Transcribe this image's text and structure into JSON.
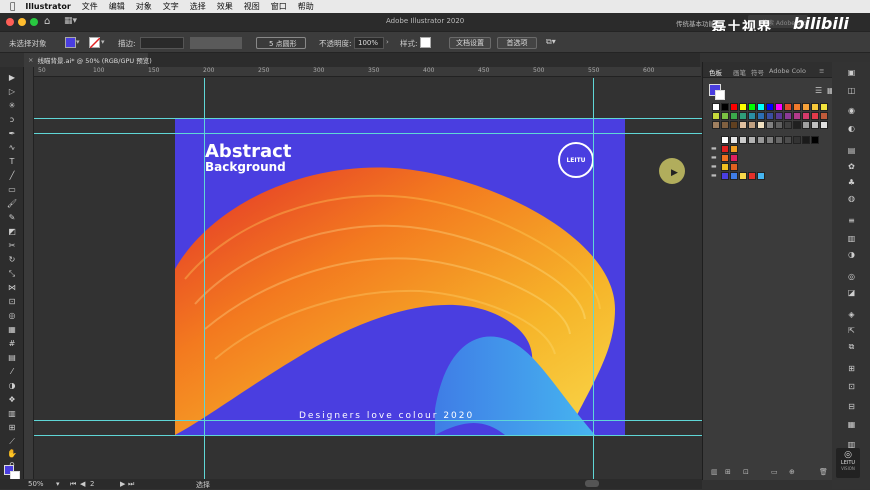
{
  "menubar": {
    "apple": "",
    "app_name": "Illustrator",
    "items": [
      "文件",
      "编辑",
      "对象",
      "文字",
      "选择",
      "效果",
      "视图",
      "窗口",
      "帮助"
    ]
  },
  "appbar": {
    "window_title": "Adobe Illustrator 2020",
    "workspace": "传统基本功能",
    "search_placeholder": "搜索 Adobe Stock",
    "watermark_text": "磊土视界",
    "watermark_logo": "bilibili"
  },
  "control": {
    "selection_label": "未选择对象",
    "stroke_label": "描边:",
    "brush_label": "5 点圆形",
    "opacity_label": "不透明度:",
    "opacity_value": "100%",
    "style_label": "样式:",
    "doc_setup_button": "文档设置",
    "prefs_button": "首选项"
  },
  "document": {
    "tab_title": "线瞄背景.ai* @ 50% (RGB/GPU 预览)"
  },
  "ruler": {
    "labels": [
      "50",
      "100",
      "150",
      "200",
      "250",
      "300",
      "350",
      "400",
      "450",
      "500",
      "550",
      "600"
    ]
  },
  "artwork": {
    "title_line1": "Abstract",
    "title_line2": "Background",
    "tagline": "Designers love colour 2020",
    "badge_text": "LEITU"
  },
  "status": {
    "zoom": "50%",
    "page": "2",
    "tool_name": "选择"
  },
  "panel": {
    "tabs": [
      "色板",
      "画笔",
      "符号",
      "Adobe Colo"
    ]
  },
  "corner_logo": {
    "line1": "LEITU",
    "line2": "VISION"
  },
  "colors": {
    "artboard_bg": "#4a3ee0",
    "guide": "#5fd6d6",
    "accent": "#f2a51d"
  }
}
